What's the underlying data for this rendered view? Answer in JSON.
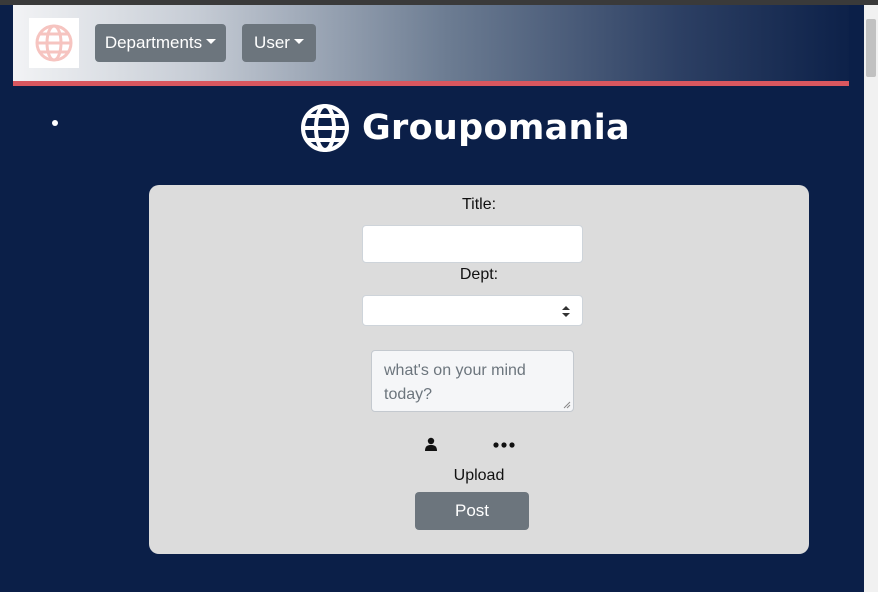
{
  "navbar": {
    "brand_icon": "globe-icon",
    "departments_label": "Departments",
    "user_label": "User",
    "accent_color": "#d9575f",
    "button_color": "#6c757d"
  },
  "header": {
    "logo_icon": "globe-icon",
    "logo_text": "Groupomania",
    "background_color": "#0b1f48"
  },
  "form": {
    "title_label": "Title:",
    "title_value": "",
    "dept_label": "Dept:",
    "dept_selected": "",
    "message_placeholder": "what's on your mind today?",
    "upload_icons": [
      "user-icon",
      "more-dots-icon"
    ],
    "upload_label": "Upload",
    "post_label": "Post"
  }
}
